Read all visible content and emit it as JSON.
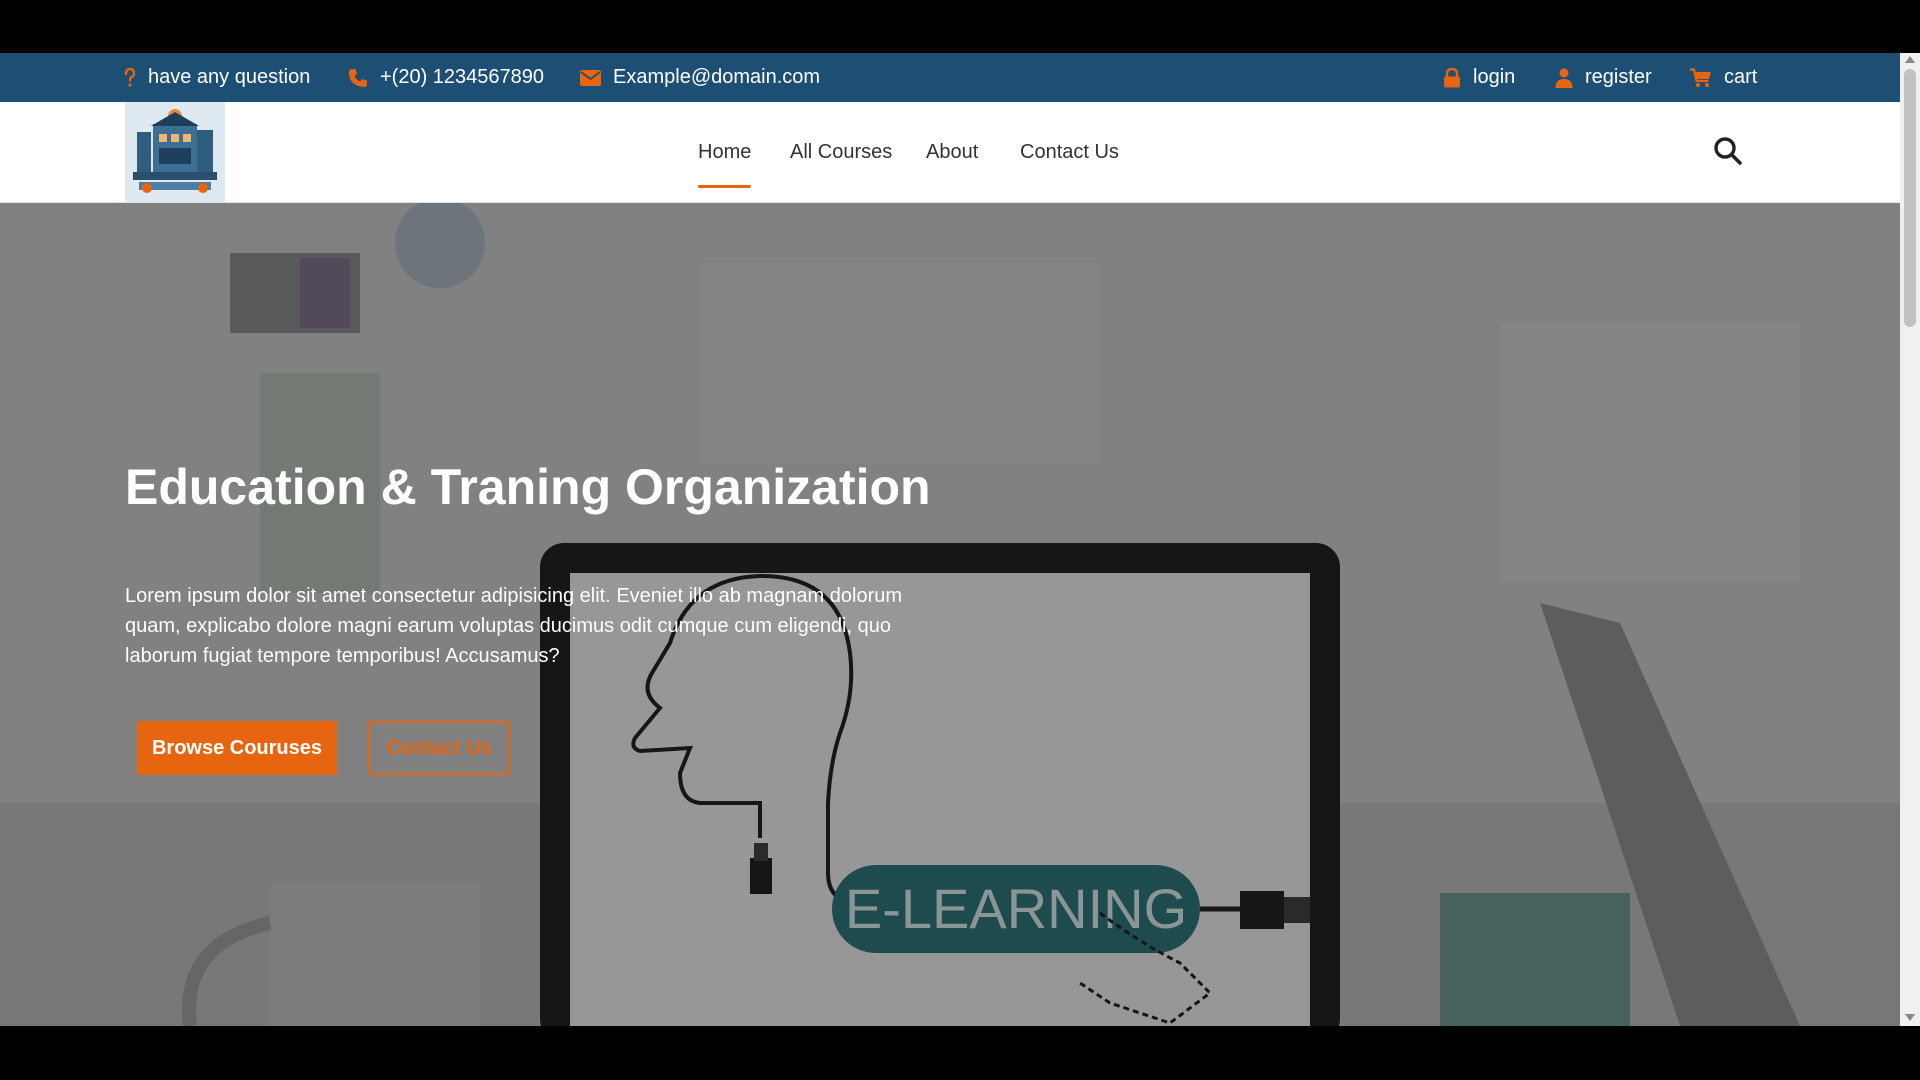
{
  "topbar": {
    "question": "have any question",
    "phone": "+(20) 1234567890",
    "email": "Example@domain.com",
    "login": "login",
    "register": "register",
    "cart": "cart"
  },
  "nav": {
    "items": [
      {
        "label": "Home",
        "active": true
      },
      {
        "label": "All Courses",
        "active": false
      },
      {
        "label": "About",
        "active": false
      },
      {
        "label": "Contact Us",
        "active": false
      }
    ]
  },
  "hero": {
    "title": "Education & Traning Organization",
    "text": "Lorem ipsum dolor sit amet consectetur adipisicing elit. Eveniet illo ab magnam dolorum quam, explicabo dolore magni earum voluptas ducimus odit cumque cum eligendi, quo laborum fugiat tempore temporibus! Accusamus?",
    "primary_button": "Browse Couruses",
    "secondary_button": "Contact Us",
    "image_badge": "E-LEARNING"
  },
  "icons": {
    "question": "question-icon",
    "phone": "phone-icon",
    "email": "envelope-icon",
    "login": "lock-icon",
    "register": "user-icon",
    "cart": "cart-icon",
    "search": "search-icon"
  },
  "colors": {
    "topbar": "#1d4e73",
    "accent": "#e8650f",
    "badge": "#1e6b6e"
  }
}
